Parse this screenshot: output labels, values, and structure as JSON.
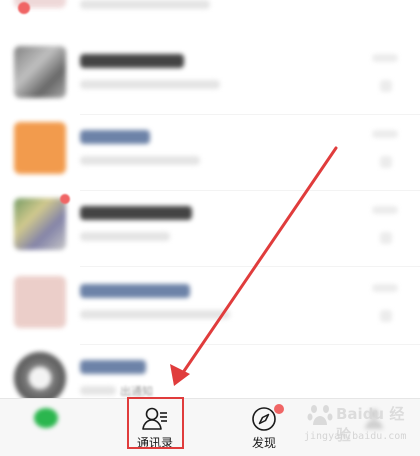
{
  "chat_list": {
    "snippet": "出通知"
  },
  "tabbar": {
    "tabs": [
      {
        "label": ""
      },
      {
        "label": "通讯录"
      },
      {
        "label": "发现"
      },
      {
        "label": ""
      },
      {
        "label": ""
      }
    ]
  },
  "watermark": {
    "brand": "Baidu 经验",
    "url": "jingyan.baidu.com"
  },
  "colors": {
    "accent_red": "#e03c3c",
    "wechat_green": "#2bb64e",
    "badge_red": "#f06565"
  },
  "icons": {
    "contacts": "contacts-icon",
    "discover": "compass-icon",
    "chats": "chats-icon",
    "me": "person-icon"
  }
}
